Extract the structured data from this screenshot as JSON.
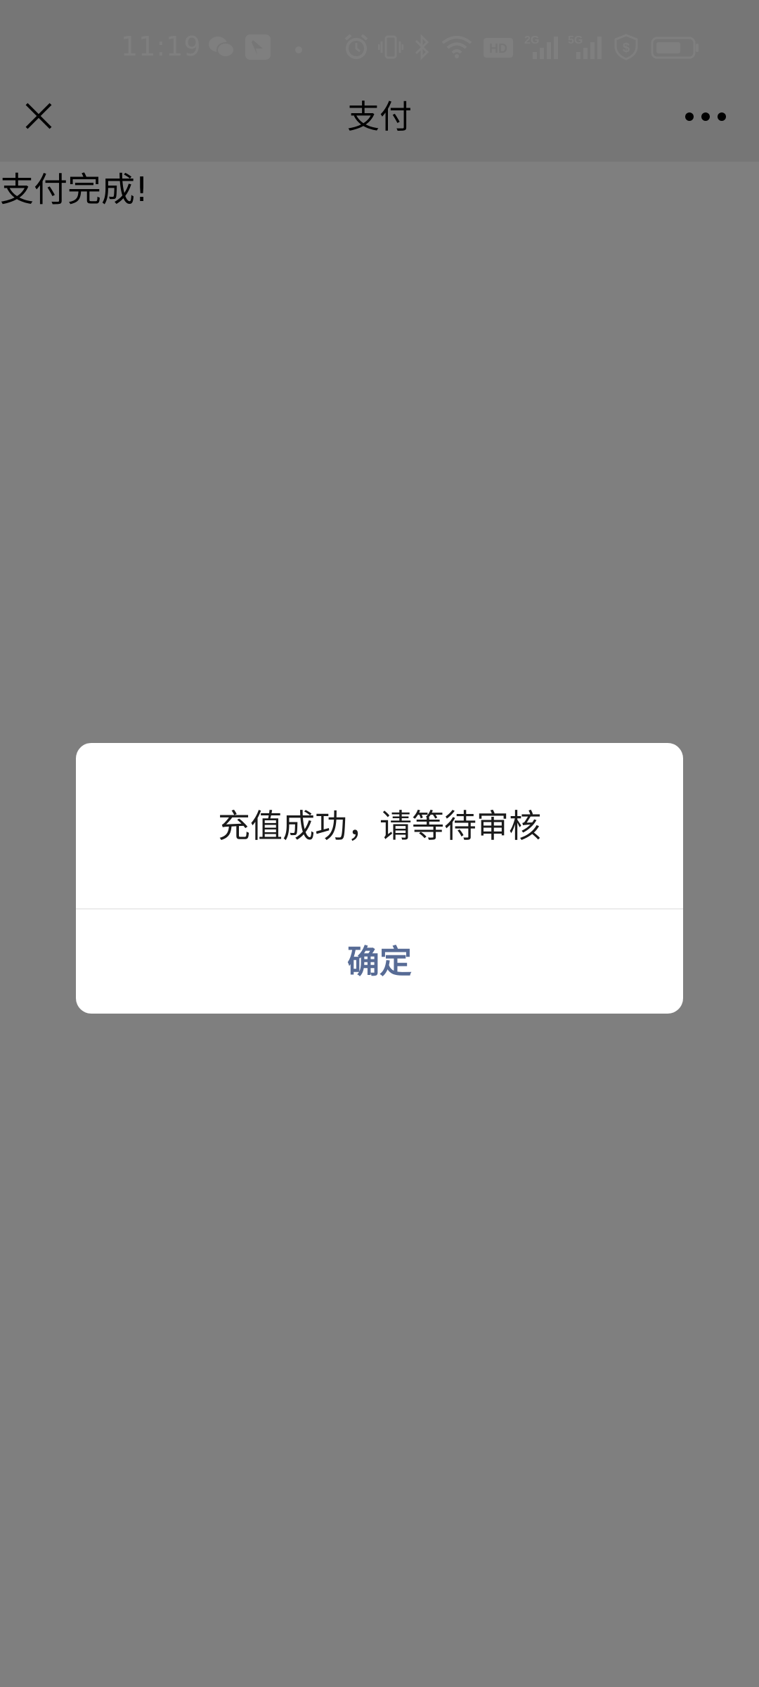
{
  "status_bar": {
    "time": "11:19",
    "icons": [
      "wechat-icon",
      "app-notification-icon",
      "dot-icon",
      "alarm-icon",
      "vibrate-icon",
      "bluetooth-icon",
      "wifi-icon",
      "hd-icon",
      "signal-2g-icon",
      "signal-5g-icon",
      "shield-icon",
      "battery-icon"
    ],
    "hd_label": "HD",
    "net_2g": "2G",
    "net_5g": "5G"
  },
  "nav": {
    "title": "支付",
    "close_icon": "close-icon",
    "more_icon": "more-icon"
  },
  "page": {
    "message": "支付完成!"
  },
  "dialog": {
    "message": "充值成功，请等待审核",
    "confirm_label": "确定"
  },
  "colors": {
    "link": "#576b95",
    "overlay": "rgba(0,0,0,0.5)"
  }
}
